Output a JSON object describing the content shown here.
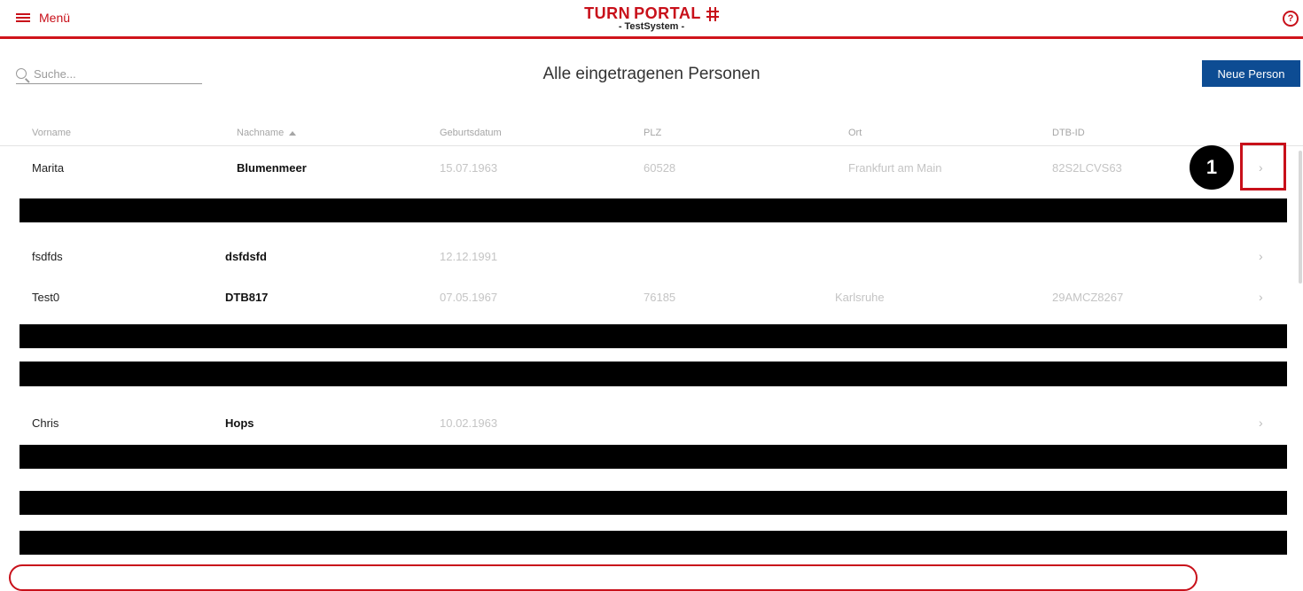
{
  "header": {
    "menu_label": "Menü",
    "brand_part1": "TURN",
    "brand_part2": "PORTAL",
    "brand_sub": "- TestSystem -",
    "help_glyph": "?"
  },
  "search": {
    "placeholder": "Suche..."
  },
  "page_title": "Alle eingetragenen Personen",
  "new_person_label": "Neue Person",
  "table": {
    "columns": [
      "Vorname",
      "Nachname",
      "Geburtsdatum",
      "PLZ",
      "Ort",
      "DTB-ID"
    ],
    "sorted_column": "Nachname",
    "rows": [
      {
        "vorname": "Marita",
        "nachname": "Blumenmeer",
        "geburtsdatum": "15.07.1963",
        "plz": "60528",
        "ort": "Frankfurt am Main",
        "dtb_id": "82S2LCVS63"
      },
      {
        "vorname": "fsdfds",
        "nachname": "dsfdsfd",
        "geburtsdatum": "12.12.1991",
        "plz": "",
        "ort": "",
        "dtb_id": ""
      },
      {
        "vorname": "Test0",
        "nachname": "DTB817",
        "geburtsdatum": "07.05.1967",
        "plz": "76185",
        "ort": "Karlsruhe",
        "dtb_id": "29AMCZ8267"
      },
      {
        "vorname": "Chris",
        "nachname": "Hops",
        "geburtsdatum": "10.02.1963",
        "plz": "",
        "ort": "",
        "dtb_id": ""
      }
    ],
    "chevron_glyph": "›"
  },
  "annotation": {
    "badge_number": "1"
  },
  "colors": {
    "brand_red": "#c8101a",
    "button_blue": "#0d4c93",
    "muted_text": "#c4c4c4"
  }
}
